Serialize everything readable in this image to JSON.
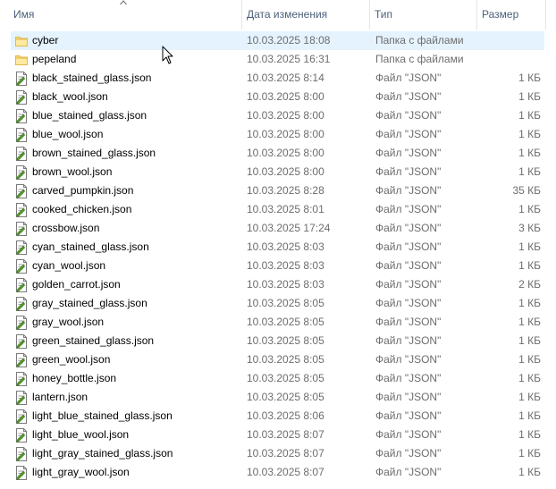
{
  "columns": {
    "name": "Имя",
    "date": "Дата изменения",
    "type": "Тип",
    "size": "Размер"
  },
  "rows": [
    {
      "name": "cyber",
      "date": "10.03.2025 18:08",
      "type": "Папка с файлами",
      "size": "",
      "icon": "folder-icon"
    },
    {
      "name": "pepeland",
      "date": "10.03.2025 16:31",
      "type": "Папка с файлами",
      "size": "",
      "icon": "folder-icon"
    },
    {
      "name": "black_stained_glass.json",
      "date": "10.03.2025 8:14",
      "type": "Файл \"JSON\"",
      "size": "1 КБ",
      "icon": "json-file-icon"
    },
    {
      "name": "black_wool.json",
      "date": "10.03.2025 8:00",
      "type": "Файл \"JSON\"",
      "size": "1 КБ",
      "icon": "json-file-icon"
    },
    {
      "name": "blue_stained_glass.json",
      "date": "10.03.2025 8:00",
      "type": "Файл \"JSON\"",
      "size": "1 КБ",
      "icon": "json-file-icon"
    },
    {
      "name": "blue_wool.json",
      "date": "10.03.2025 8:00",
      "type": "Файл \"JSON\"",
      "size": "1 КБ",
      "icon": "json-file-icon"
    },
    {
      "name": "brown_stained_glass.json",
      "date": "10.03.2025 8:00",
      "type": "Файл \"JSON\"",
      "size": "1 КБ",
      "icon": "json-file-icon"
    },
    {
      "name": "brown_wool.json",
      "date": "10.03.2025 8:00",
      "type": "Файл \"JSON\"",
      "size": "1 КБ",
      "icon": "json-file-icon"
    },
    {
      "name": "carved_pumpkin.json",
      "date": "10.03.2025 8:28",
      "type": "Файл \"JSON\"",
      "size": "35 КБ",
      "icon": "json-file-icon"
    },
    {
      "name": "cooked_chicken.json",
      "date": "10.03.2025 8:01",
      "type": "Файл \"JSON\"",
      "size": "1 КБ",
      "icon": "json-file-icon"
    },
    {
      "name": "crossbow.json",
      "date": "10.03.2025 17:24",
      "type": "Файл \"JSON\"",
      "size": "3 КБ",
      "icon": "json-file-icon"
    },
    {
      "name": "cyan_stained_glass.json",
      "date": "10.03.2025 8:03",
      "type": "Файл \"JSON\"",
      "size": "1 КБ",
      "icon": "json-file-icon"
    },
    {
      "name": "cyan_wool.json",
      "date": "10.03.2025 8:03",
      "type": "Файл \"JSON\"",
      "size": "1 КБ",
      "icon": "json-file-icon"
    },
    {
      "name": "golden_carrot.json",
      "date": "10.03.2025 8:03",
      "type": "Файл \"JSON\"",
      "size": "2 КБ",
      "icon": "json-file-icon"
    },
    {
      "name": "gray_stained_glass.json",
      "date": "10.03.2025 8:05",
      "type": "Файл \"JSON\"",
      "size": "1 КБ",
      "icon": "json-file-icon"
    },
    {
      "name": "gray_wool.json",
      "date": "10.03.2025 8:05",
      "type": "Файл \"JSON\"",
      "size": "1 КБ",
      "icon": "json-file-icon"
    },
    {
      "name": "green_stained_glass.json",
      "date": "10.03.2025 8:05",
      "type": "Файл \"JSON\"",
      "size": "1 КБ",
      "icon": "json-file-icon"
    },
    {
      "name": "green_wool.json",
      "date": "10.03.2025 8:05",
      "type": "Файл \"JSON\"",
      "size": "1 КБ",
      "icon": "json-file-icon"
    },
    {
      "name": "honey_bottle.json",
      "date": "10.03.2025 8:05",
      "type": "Файл \"JSON\"",
      "size": "1 КБ",
      "icon": "json-file-icon"
    },
    {
      "name": "lantern.json",
      "date": "10.03.2025 8:05",
      "type": "Файл \"JSON\"",
      "size": "1 КБ",
      "icon": "json-file-icon"
    },
    {
      "name": "light_blue_stained_glass.json",
      "date": "10.03.2025 8:06",
      "type": "Файл \"JSON\"",
      "size": "1 КБ",
      "icon": "json-file-icon"
    },
    {
      "name": "light_blue_wool.json",
      "date": "10.03.2025 8:07",
      "type": "Файл \"JSON\"",
      "size": "1 КБ",
      "icon": "json-file-icon"
    },
    {
      "name": "light_gray_stained_glass.json",
      "date": "10.03.2025 8:07",
      "type": "Файл \"JSON\"",
      "size": "1 КБ",
      "icon": "json-file-icon"
    },
    {
      "name": "light_gray_wool.json",
      "date": "10.03.2025 8:07",
      "type": "Файл \"JSON\"",
      "size": "1 КБ",
      "icon": "json-file-icon"
    }
  ],
  "hovered_row": "cyber"
}
